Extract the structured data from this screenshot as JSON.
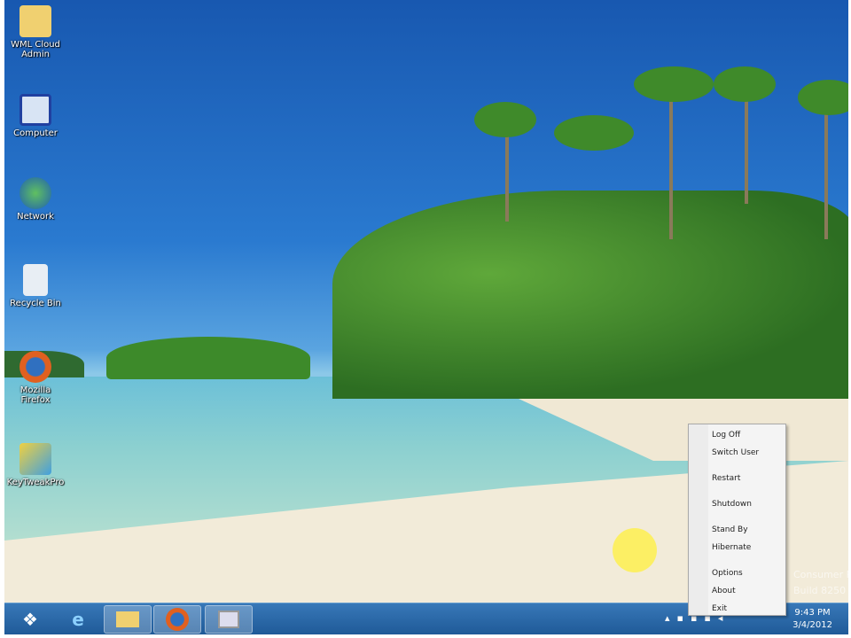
{
  "desktop_icons": [
    {
      "label": "WML Cloud Admin",
      "icon": "folder-user-icon"
    },
    {
      "label": "Computer",
      "icon": "computer-icon"
    },
    {
      "label": "Network",
      "icon": "network-icon"
    },
    {
      "label": "Recycle Bin",
      "icon": "recycle-bin-icon"
    },
    {
      "label": "Mozilla Firefox",
      "icon": "firefox-icon"
    },
    {
      "label": "KeyTweakPro",
      "icon": "app-icon"
    }
  ],
  "context_menu": {
    "items": [
      "Log Off",
      "Switch User",
      "Restart",
      "Shutdown",
      "Stand By",
      "Hibernate",
      "Options",
      "About",
      "Exit"
    ]
  },
  "watermark": {
    "line1": "Consumer Preview",
    "line2": "Build 8250"
  },
  "taskbar": {
    "time": "9:43 PM",
    "date": "3/4/2012"
  }
}
